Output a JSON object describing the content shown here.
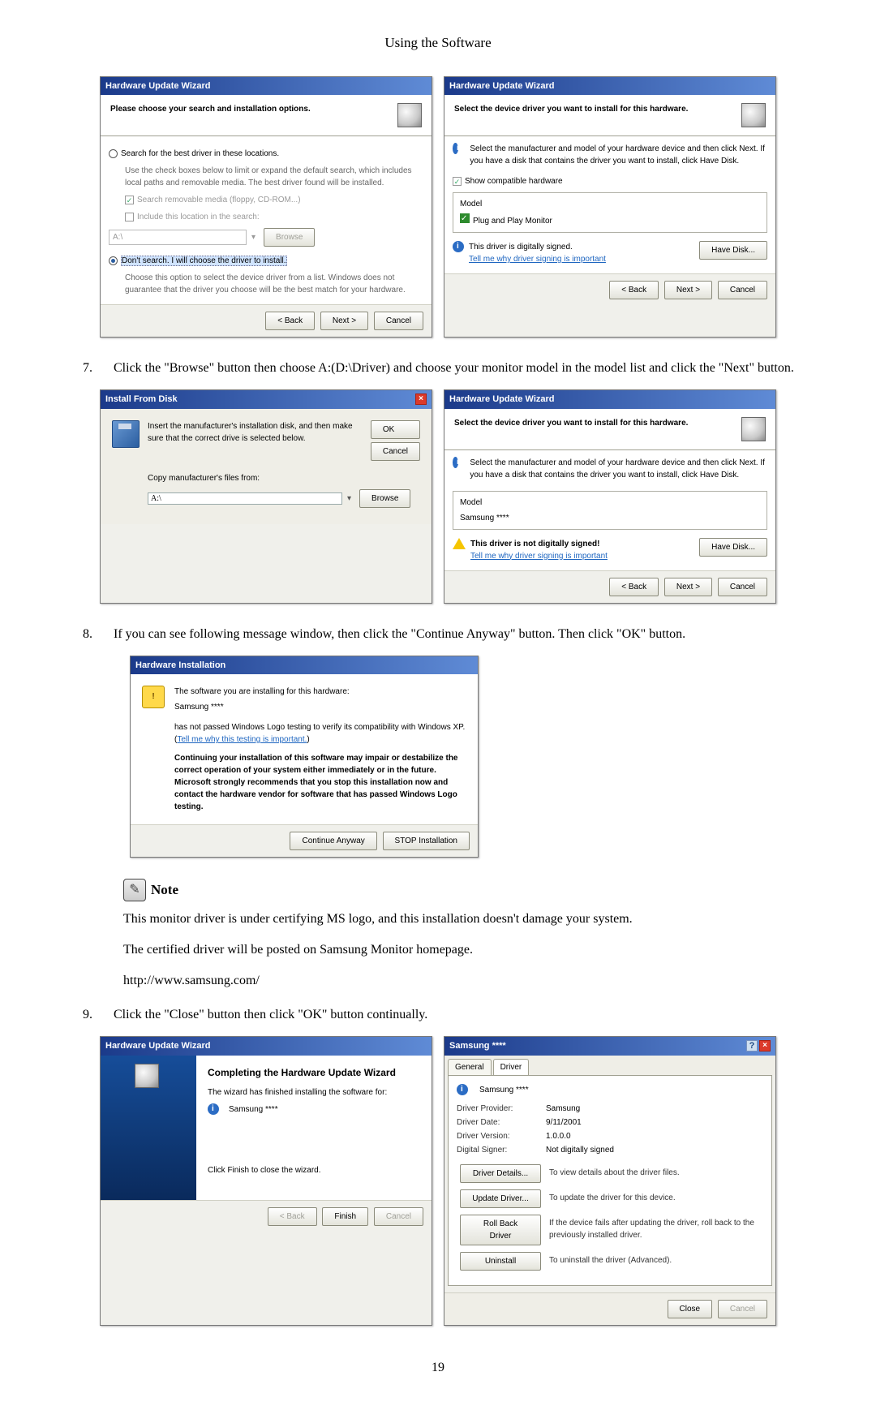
{
  "page_header": "Using the Software",
  "page_number": "19",
  "steps": {
    "s7": {
      "num": "7.",
      "text": "Click the \"Browse\" button then choose A:(D:\\Driver) and choose your monitor model in the model list and click the \"Next\" button."
    },
    "s8": {
      "num": "8.",
      "text": "If you can see following message window, then click the \"Continue Anyway\" button. Then click \"OK\" button."
    },
    "s9": {
      "num": "9.",
      "text": "Click the \"Close\" button then click \"OK\" button continually."
    }
  },
  "note": {
    "label": "Note",
    "line1": "This monitor driver is under certifying MS logo, and this installation doesn't damage your system.",
    "line2": "The certified driver will be posted on Samsung Monitor homepage.",
    "url": "http://www.samsung.com/"
  },
  "dlg": {
    "huw_title": "Hardware Update Wizard",
    "back": "< Back",
    "next": "Next >",
    "cancel": "Cancel",
    "finish": "Finish",
    "have_disk": "Have Disk...",
    "search_heading": "Please choose your search and installation options.",
    "search_opt": "Search for the best driver in these locations.",
    "search_desc": "Use the check boxes below to limit or expand the default search, which includes local paths and removable media. The best driver found will be installed.",
    "chk_media": "Search removable media (floppy, CD-ROM...)",
    "chk_include": "Include this location in the search:",
    "browse": "Browse",
    "path_placeholder": "A:\\",
    "dont_opt": "Don't search. I will choose the driver to install.",
    "dont_desc": "Choose this option to select the device driver from a list. Windows does not guarantee that the driver you choose will be the best match for your hardware.",
    "select_heading": "Select the device driver you want to install for this hardware.",
    "select_desc": "Select the manufacturer and model of your hardware device and then click Next. If you have a disk that contains the driver you want to install, click Have Disk.",
    "show_compat": "Show compatible hardware",
    "model_label": "Model",
    "model_pnp": "Plug and Play Monitor",
    "signed_msg": "This driver is digitally signed.",
    "sign_link": "Tell me why driver signing is important",
    "model_samsung": "Samsung ****",
    "not_signed_msg": "This driver is not digitally signed!",
    "install_title": "Install From Disk",
    "install_msg": "Insert the manufacturer's installation disk, and then make sure that the correct drive is selected below.",
    "ok": "OK",
    "copy_label": "Copy manufacturer's files from:",
    "hwinst_title": "Hardware Installation",
    "hwinst_intro": "The software you are installing for this hardware:",
    "hwinst_samsung": "Samsung ****",
    "hwinst_nolog": "has not passed Windows Logo testing to verify its compatibility with Windows XP. (",
    "hwinst_link": "Tell me why this testing is important.",
    "hwinst_close": ")",
    "hwinst_bold": "Continuing your installation of this software may impair or destabilize the correct operation of your system either immediately or in the future. Microsoft strongly recommends that you stop this installation now and contact the hardware vendor for software that has passed Windows Logo testing.",
    "cont_anyway": "Continue Anyway",
    "stop_install": "STOP Installation",
    "complete_h": "Completing the Hardware Update Wizard",
    "complete_msg": "The wizard has finished installing the software for:",
    "complete_sam": "Samsung ****",
    "complete_click": "Click Finish to close the wizard.",
    "prop_title": "Samsung ****",
    "tab_general": "General",
    "tab_driver": "Driver",
    "prop_name": "Samsung ****",
    "prov_k": "Driver Provider:",
    "prov_v": "Samsung",
    "date_k": "Driver Date:",
    "date_v": "9/11/2001",
    "ver_k": "Driver Version:",
    "ver_v": "1.0.0.0",
    "sig_k": "Digital Signer:",
    "sig_v": "Not digitally signed",
    "btn_details": "Driver Details...",
    "desc_details": "To view details about the driver files.",
    "btn_update": "Update Driver...",
    "desc_update": "To update the driver for this device.",
    "btn_roll": "Roll Back Driver",
    "desc_roll": "If the device fails after updating the driver, roll back to the previously installed driver.",
    "btn_uninst": "Uninstall",
    "desc_uninst": "To uninstall the driver (Advanced).",
    "close": "Close"
  }
}
